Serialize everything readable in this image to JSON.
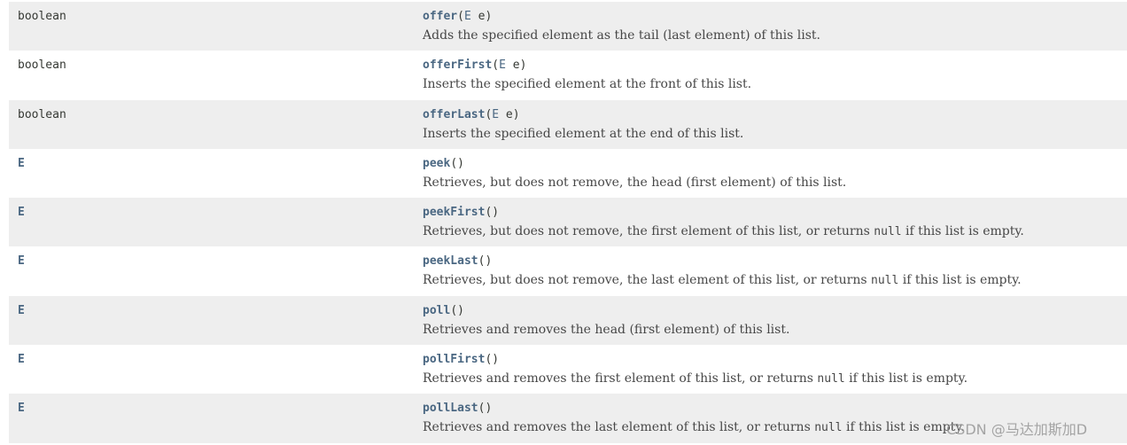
{
  "rows": [
    {
      "return_type": "boolean",
      "method_name": "offer",
      "open": "(",
      "param_type": "E",
      "param_name": " e",
      "close": ")",
      "desc_before": "Adds the specified element as the tail (last element) of this list.",
      "desc_code": "",
      "desc_after": ""
    },
    {
      "return_type": "boolean",
      "method_name": "offerFirst",
      "open": "(",
      "param_type": "E",
      "param_name": " e",
      "close": ")",
      "desc_before": "Inserts the specified element at the front of this list.",
      "desc_code": "",
      "desc_after": ""
    },
    {
      "return_type": "boolean",
      "method_name": "offerLast",
      "open": "(",
      "param_type": "E",
      "param_name": " e",
      "close": ")",
      "desc_before": "Inserts the specified element at the end of this list.",
      "desc_code": "",
      "desc_after": ""
    },
    {
      "return_type": "E",
      "method_name": "peek",
      "open": "(",
      "param_type": "",
      "param_name": "",
      "close": ")",
      "desc_before": "Retrieves, but does not remove, the head (first element) of this list.",
      "desc_code": "",
      "desc_after": ""
    },
    {
      "return_type": "E",
      "method_name": "peekFirst",
      "open": "(",
      "param_type": "",
      "param_name": "",
      "close": ")",
      "desc_before": "Retrieves, but does not remove, the first element of this list, or returns ",
      "desc_code": "null",
      "desc_after": " if this list is empty."
    },
    {
      "return_type": "E",
      "method_name": "peekLast",
      "open": "(",
      "param_type": "",
      "param_name": "",
      "close": ")",
      "desc_before": "Retrieves, but does not remove, the last element of this list, or returns ",
      "desc_code": "null",
      "desc_after": " if this list is empty."
    },
    {
      "return_type": "E",
      "method_name": "poll",
      "open": "(",
      "param_type": "",
      "param_name": "",
      "close": ")",
      "desc_before": "Retrieves and removes the head (first element) of this list.",
      "desc_code": "",
      "desc_after": ""
    },
    {
      "return_type": "E",
      "method_name": "pollFirst",
      "open": "(",
      "param_type": "",
      "param_name": "",
      "close": ")",
      "desc_before": "Retrieves and removes the first element of this list, or returns ",
      "desc_code": "null",
      "desc_after": " if this list is empty."
    },
    {
      "return_type": "E",
      "method_name": "pollLast",
      "open": "(",
      "param_type": "",
      "param_name": "",
      "close": ")",
      "desc_before": "Retrieves and removes the last element of this list, or returns ",
      "desc_code": "null",
      "desc_after": " if this list is empty."
    }
  ],
  "watermark": "CSDN @马达加斯加D",
  "colors": {
    "link": "#4a6782",
    "alt_row": "#eeeeee",
    "text": "#474747"
  }
}
